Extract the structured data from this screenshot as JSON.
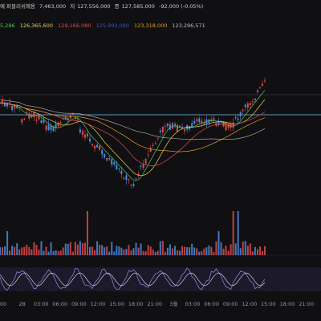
{
  "header": {
    "title_fragment": "예 파블리쉬혜용",
    "open_value": "7,463,000",
    "high_label": "저",
    "low_value": "127,556,000",
    "close_label": "종",
    "close_value": "127,585,000",
    "change_value": "-92,000 (-0.05%)"
  },
  "moving_averages": [
    {
      "value": "5,286",
      "color": "#49c85a"
    },
    {
      "value": "126,365,600",
      "color": "#e6d24a"
    },
    {
      "value": "129,166,080",
      "color": "#e04a4a"
    },
    {
      "value": "125,993,080",
      "color": "#3a4fd6"
    },
    {
      "value": "123,318,000",
      "color": "#e89a2a"
    },
    {
      "value": "123,296,571",
      "color": "#bdbdbd"
    }
  ],
  "x_axis": {
    "ticks": [
      "00",
      "28",
      "03:00",
      "06:00",
      "09:00",
      "12:00",
      "15:00",
      "18:00",
      "21:00",
      "3월",
      "03:00",
      "06:00",
      "09:00",
      "12:00",
      "15:00",
      "18:00",
      "21:00"
    ]
  },
  "colors": {
    "up": "#e04a4a",
    "down": "#4a8be0",
    "horizontal_line": "#6ec6ff",
    "oscillator": "#8e7ad6",
    "signal": "#e8e8e8"
  }
}
